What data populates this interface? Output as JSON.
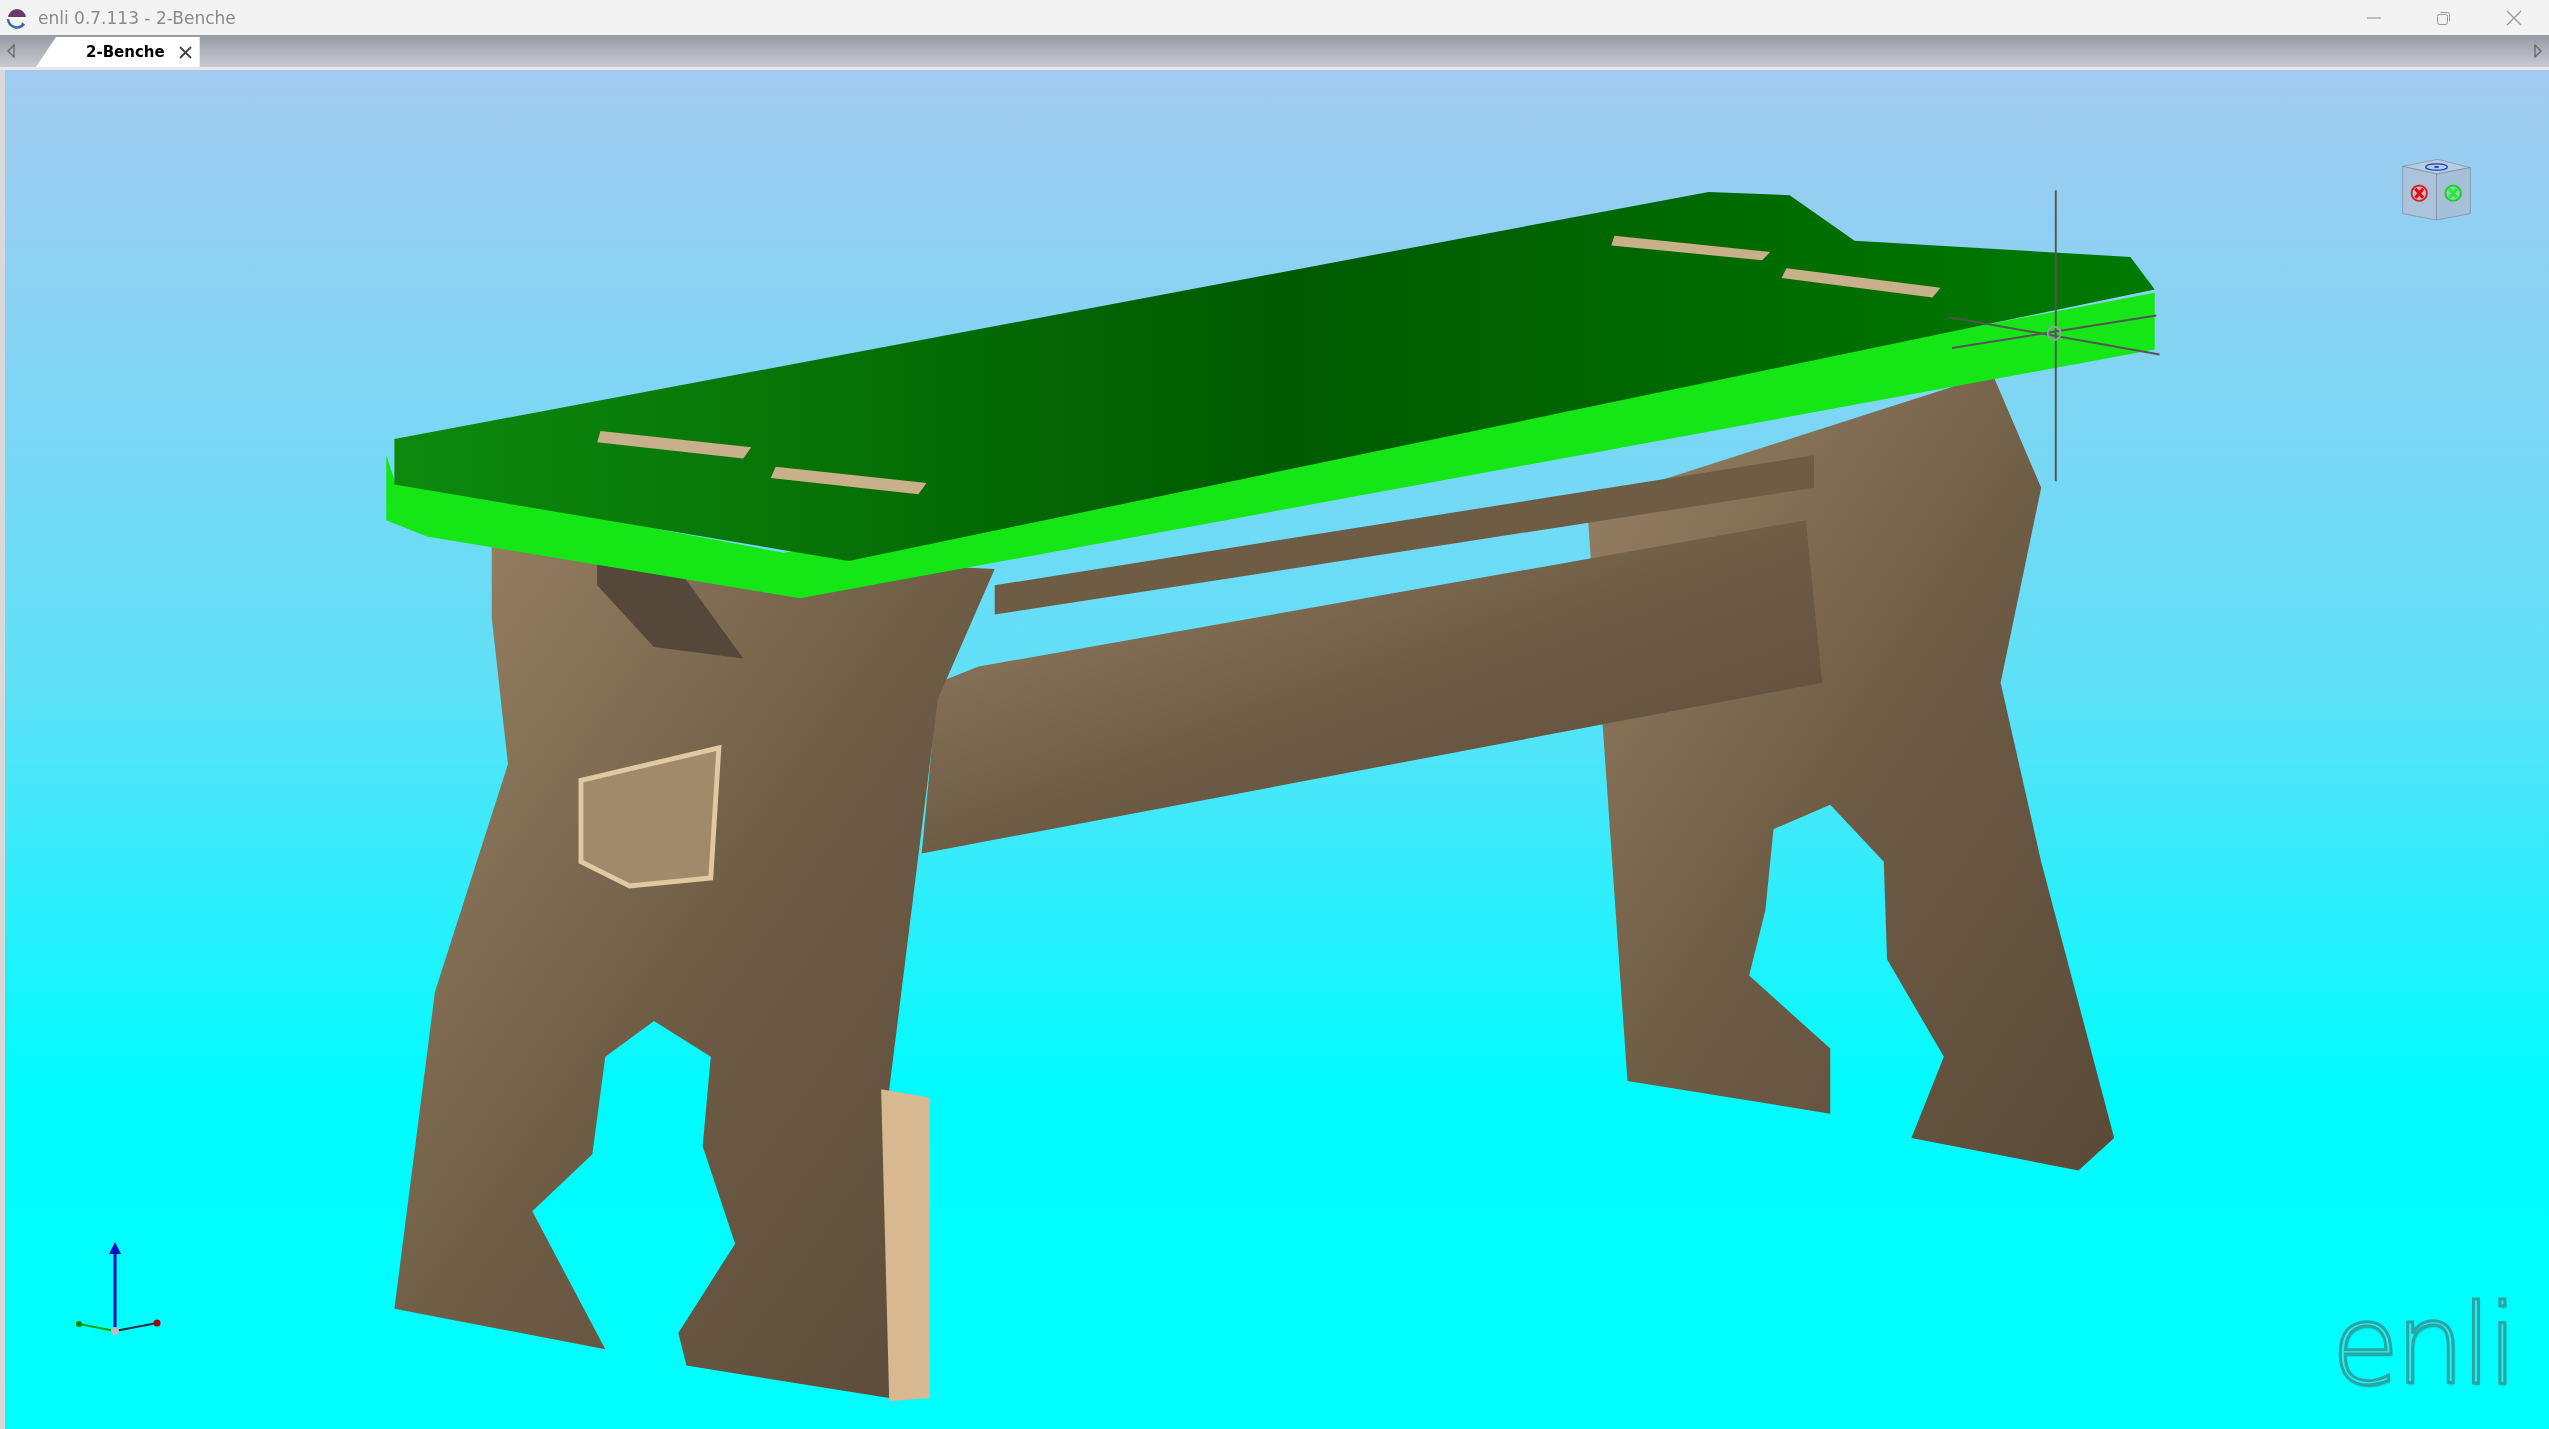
{
  "window": {
    "title": "enli 0.7.113 - 2-Benche"
  },
  "tabs": [
    {
      "label": "2-Benche",
      "selected": true
    }
  ],
  "viewport": {
    "logo": "enli"
  }
}
